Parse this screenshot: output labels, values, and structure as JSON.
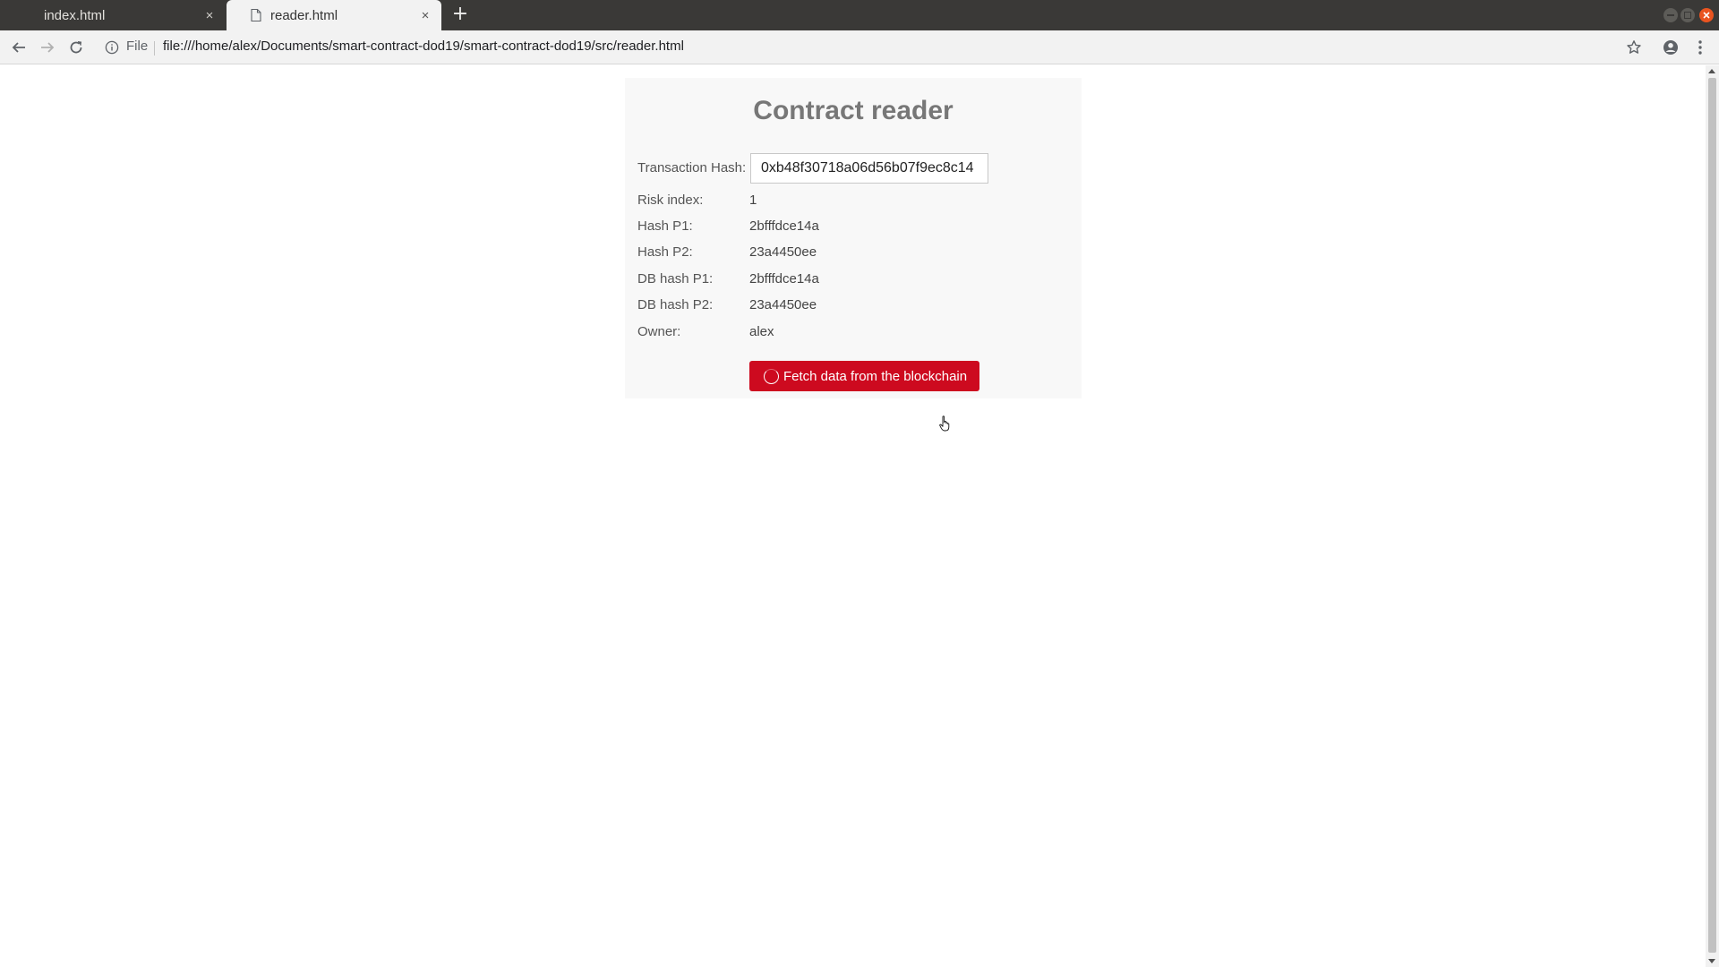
{
  "browser": {
    "tabs": [
      {
        "title": "index.html",
        "active": false
      },
      {
        "title": "reader.html",
        "active": true
      }
    ],
    "close_glyph": "×",
    "new_tab_glyph": "+",
    "address": {
      "scheme_label": "File",
      "url": "file:///home/alex/Documents/smart-contract-dod19/smart-contract-dod19/src/reader.html"
    },
    "icons": {
      "back": "back-arrow-icon",
      "forward": "forward-arrow-icon",
      "reload": "reload-icon",
      "info": "info-icon",
      "bookmark": "star-icon",
      "account": "account-icon",
      "menu": "kebab-menu-icon"
    }
  },
  "page": {
    "title": "Contract reader",
    "hash_field": {
      "label": "Transaction Hash:",
      "value": "0xb48f30718a06d56b07f9ec8c14"
    },
    "fields": [
      {
        "label": "Risk index:",
        "value": "1"
      },
      {
        "label": "Hash P1:",
        "value": "2bfffdce14a"
      },
      {
        "label": "Hash P2:",
        "value": "23a4450ee"
      },
      {
        "label": "DB hash P1:",
        "value": "2bfffdce14a"
      },
      {
        "label": "DB hash P2:",
        "value": "23a4450ee"
      },
      {
        "label": "Owner:",
        "value": "alex"
      }
    ],
    "fetch_button": {
      "label": "Fetch data from the blockchain"
    }
  },
  "colors": {
    "button": "#cd0a1f",
    "title": "#777777",
    "tabstrip": "#3a3937",
    "close_window": "#e95420"
  }
}
